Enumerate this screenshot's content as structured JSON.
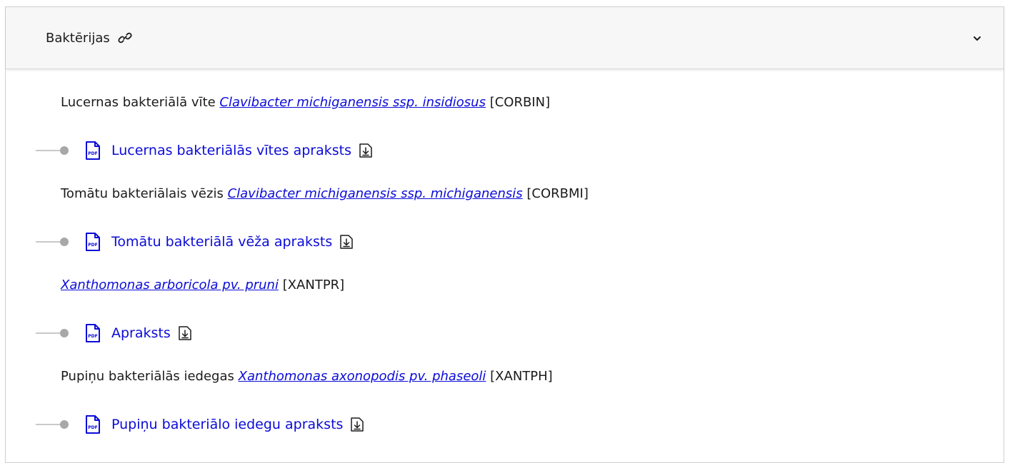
{
  "section": {
    "title": "Baktērijas",
    "link_icon": "link-icon",
    "toggle_icon": "chevron-down-icon"
  },
  "items": [
    {
      "prefix": "Lucernas bakteriālā vīte ",
      "latin": "Clavibacter michiganensis ssp. insidiosus",
      "code": " [CORBIN]",
      "doc": "Lucernas bakteriālās vītes apraksts"
    },
    {
      "prefix": "Tomātu bakteriālais vēzis ",
      "latin": "Clavibacter michiganensis ssp. michiganensis",
      "code": " [CORBMI]",
      "doc": "Tomātu bakteriālā vēža apraksts"
    },
    {
      "prefix": "",
      "latin": "Xanthomonas arboricola pv. pruni",
      "code": " [XANTPR]",
      "doc": "Apraksts"
    },
    {
      "prefix": "Pupiņu bakteriālās iedegas ",
      "latin": "Xanthomonas axonopodis pv. phaseoli",
      "code": " [XANTPH]",
      "doc": "Pupiņu bakteriālo iedegu apraksts"
    }
  ],
  "icons": {
    "document": "pdf-file-icon",
    "download": "download-icon",
    "bullet": "timeline-dot"
  },
  "colors": {
    "link": "#0b0bd8",
    "text": "#1b1b1b",
    "header_bg": "#f7f7f7",
    "border": "#d0d0d0"
  }
}
